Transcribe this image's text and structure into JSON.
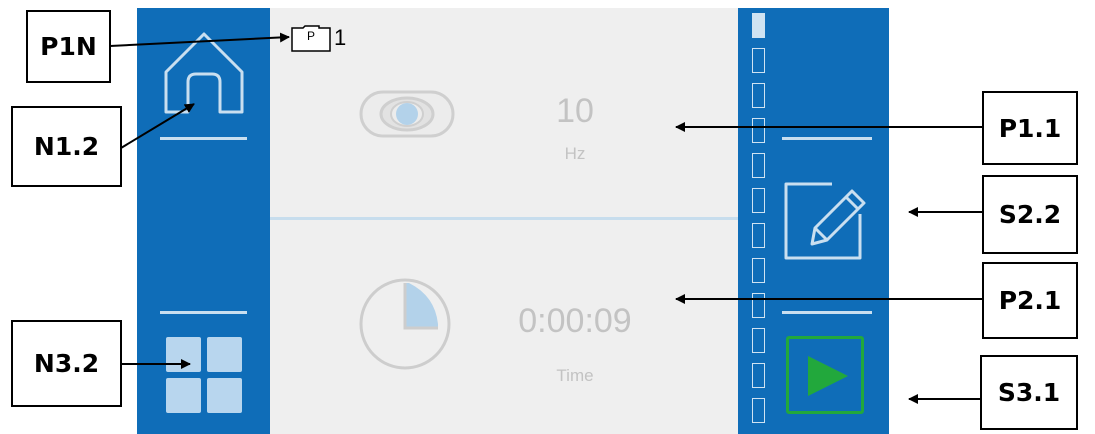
{
  "callouts": {
    "p1n": "P1N",
    "n1_2": "N1.2",
    "n3_2": "N3.2",
    "p1_1": "P1.1",
    "s2_2": "S2.2",
    "p2_1": "P2.1",
    "s3_1": "S3.1"
  },
  "page_indicator": {
    "folder_letter": "P",
    "page_number": "1"
  },
  "param1": {
    "value": "10",
    "unit": "Hz",
    "icon": "oscillation-icon"
  },
  "param2": {
    "value": "0:00:09",
    "label": "Time",
    "icon": "timer-icon"
  },
  "nav": {
    "home_icon": "home-icon",
    "menu_icon": "grid-menu-icon"
  },
  "actions": {
    "edit_icon": "edit-icon",
    "start_icon": "play-icon"
  },
  "colors": {
    "panel": "#0f6db8",
    "content_bg": "#efefef",
    "play": "#22a83c"
  }
}
